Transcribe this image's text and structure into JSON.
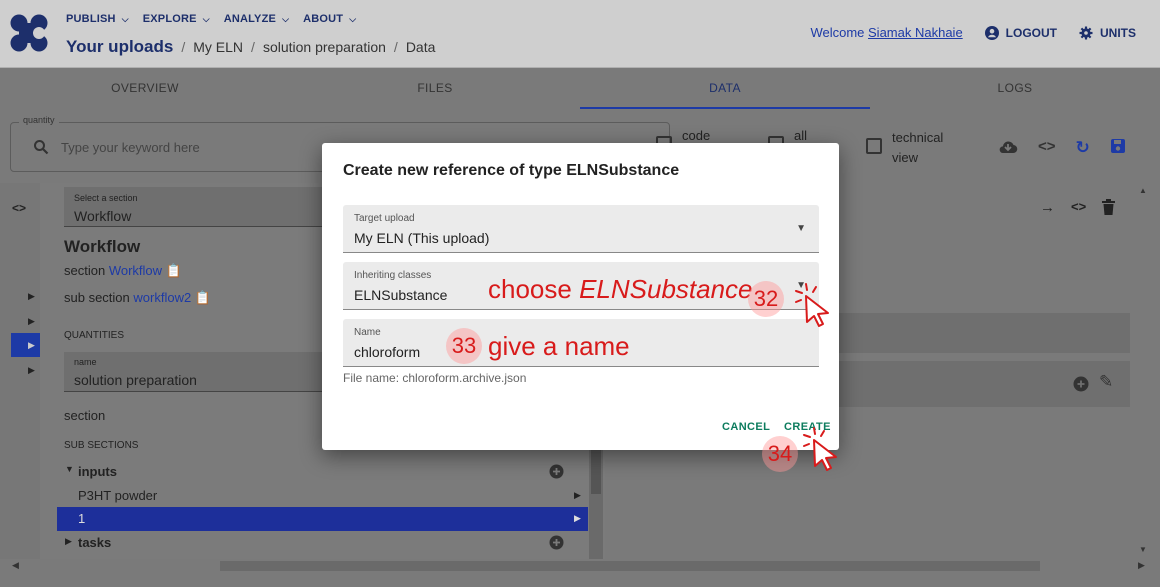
{
  "header": {
    "nav": [
      {
        "label": "PUBLISH"
      },
      {
        "label": "EXPLORE"
      },
      {
        "label": "ANALYZE"
      },
      {
        "label": "ABOUT"
      }
    ],
    "breadcrumb": {
      "title": "Your uploads",
      "parts": [
        "My ELN",
        "solution preparation",
        "Data"
      ]
    },
    "welcome_prefix": "Welcome",
    "user_name": "Siamak Nakhaie",
    "logout_label": "LOGOUT",
    "units_label": "UNITS"
  },
  "tabs": [
    {
      "label": "OVERVIEW",
      "active": false
    },
    {
      "label": "FILES",
      "active": false
    },
    {
      "label": "DATA",
      "active": true
    },
    {
      "label": "LOGS",
      "active": false
    }
  ],
  "toolbar": {
    "search_label": "quantity",
    "search_placeholder": "Type your keyword here",
    "check_code": "code",
    "check_all": "all",
    "check_technical_1": "technical",
    "check_technical_2": "view"
  },
  "left": {
    "select_label": "Select a section",
    "select_value": "Workflow",
    "heading": "Workflow",
    "section_label": "section",
    "section_link": "Workflow",
    "subsection_label": "sub section",
    "subsection_link": "workflow2",
    "quantities_header": "QUANTITIES",
    "name_label": "name",
    "name_value": "solution preparation",
    "section_text": "section",
    "subsections_header": "SUB SECTIONS",
    "inputs_label": "inputs",
    "input_item": "P3HT powder",
    "selected_item": "1",
    "tasks_label": "tasks"
  },
  "modal": {
    "title": "Create new reference of type ELNSubstance",
    "target_upload_label": "Target upload",
    "target_upload_value": "My ELN (This upload)",
    "inheriting_label": "Inheriting classes",
    "inheriting_value": "ELNSubstance",
    "name_label": "Name",
    "name_value": "chloroform",
    "file_hint": "File name: chloroform.archive.json",
    "cancel_label": "CANCEL",
    "create_label": "CREATE"
  },
  "annotations": {
    "choose_prefix": "choose ",
    "choose_class": "ELNSubstance",
    "give_name": "give a name",
    "step_32": "32",
    "step_33": "33",
    "step_34": "34"
  },
  "colors": {
    "brand": "#1d2f6b",
    "link": "#1d3aa6",
    "action_green": "#0d7c5e",
    "annotation_red": "#d81b1b"
  },
  "icons": {
    "logout": "account-circle-icon",
    "units": "gear-icon",
    "search": "search-icon",
    "upload": "cloud-download-icon",
    "code": "code-icon",
    "reload": "reload-icon",
    "save": "save-icon"
  }
}
